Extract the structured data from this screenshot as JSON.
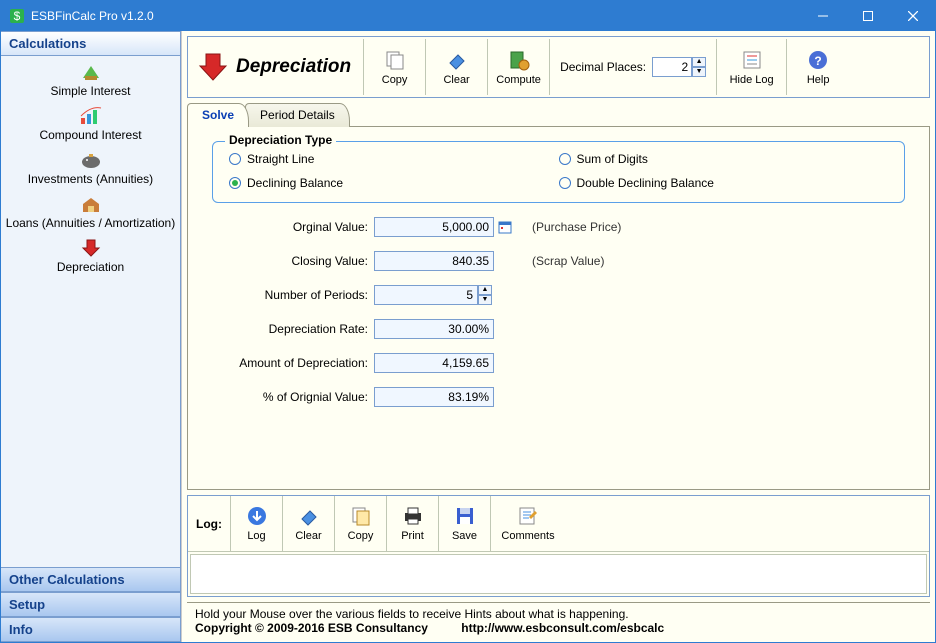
{
  "window": {
    "title": "ESBFinCalc Pro v1.2.0"
  },
  "sidebar": {
    "header_calculations": "Calculations",
    "header_other": "Other Calculations",
    "header_setup": "Setup",
    "header_info": "Info",
    "items": [
      {
        "label": "Simple Interest"
      },
      {
        "label": "Compound Interest"
      },
      {
        "label": "Investments (Annuities)"
      },
      {
        "label": "Loans (Annuities / Amortization)"
      },
      {
        "label": "Depreciation"
      }
    ]
  },
  "toolbar": {
    "title": "Depreciation",
    "copy": "Copy",
    "clear": "Clear",
    "compute": "Compute",
    "decimal_label": "Decimal Places:",
    "decimal_value": "2",
    "hidelog": "Hide Log",
    "help": "Help"
  },
  "tabs": {
    "solve": "Solve",
    "period_details": "Period Details"
  },
  "dep_type": {
    "legend": "Depreciation Type",
    "straight": "Straight Line",
    "sumdigits": "Sum of Digits",
    "declining": "Declining Balance",
    "double": "Double Declining Balance"
  },
  "form": {
    "orig_label": "Orginal Value:",
    "orig_value": "5,000.00",
    "orig_hint": "(Purchase Price)",
    "close_label": "Closing Value:",
    "close_value": "840.35",
    "close_hint": "(Scrap Value)",
    "periods_label": "Number of Periods:",
    "periods_value": "5",
    "rate_label": "Depreciation Rate:",
    "rate_value": "30.00%",
    "amount_label": "Amount of Depreciation:",
    "amount_value": "4,159.65",
    "pct_label": "% of Orignial Value:",
    "pct_value": "83.19%"
  },
  "log": {
    "label": "Log:",
    "log": "Log",
    "clear": "Clear",
    "copy": "Copy",
    "print": "Print",
    "save": "Save",
    "comments": "Comments"
  },
  "footer": {
    "hint": "Hold your Mouse over the various fields to receive Hints about what is happening.",
    "copyright": "Copyright © 2009-2016 ESB Consultancy",
    "url": "http://www.esbconsult.com/esbcalc"
  }
}
